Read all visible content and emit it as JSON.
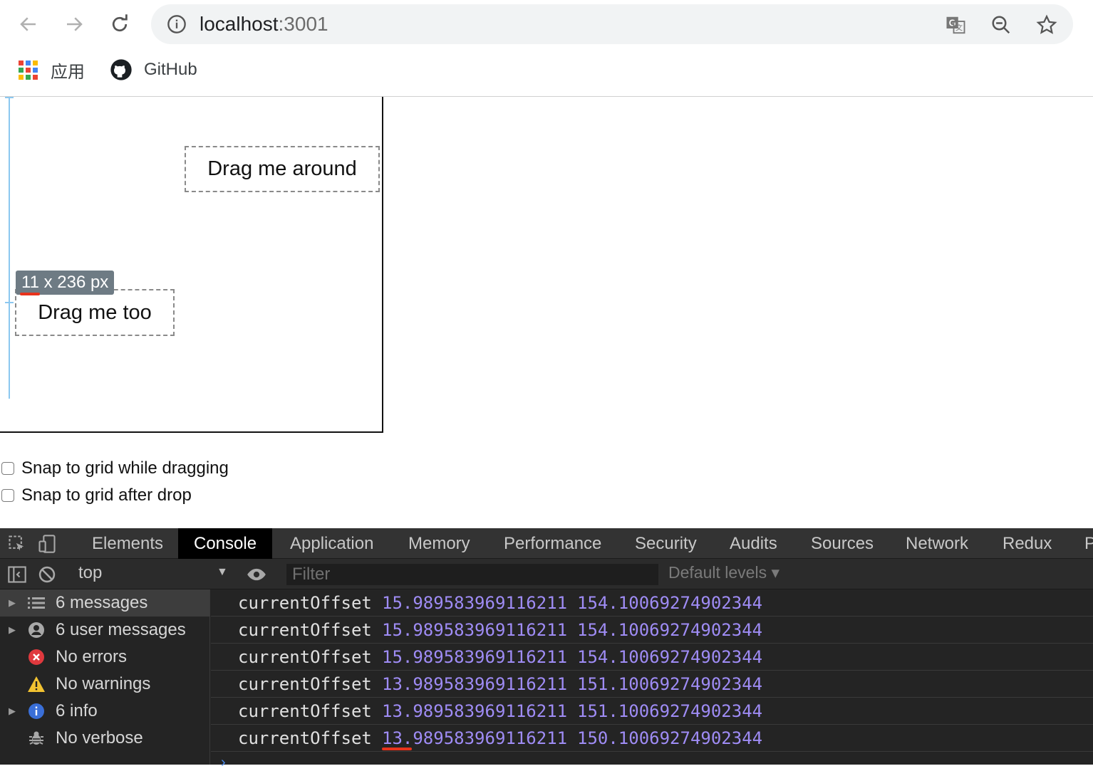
{
  "browser": {
    "url_host": "localhost",
    "url_port": ":3001",
    "bookmarks": [
      {
        "label": "应用",
        "icon": "apps-grid-icon"
      },
      {
        "label": "GitHub",
        "icon": "github-icon"
      }
    ]
  },
  "page": {
    "drag_box_1": "Drag me around",
    "drag_box_2": "Drag me too",
    "size_tooltip": "11 x 236 px",
    "checkboxes": [
      {
        "label": "Snap to grid while dragging",
        "checked": false
      },
      {
        "label": "Snap to grid after drop",
        "checked": false
      }
    ]
  },
  "devtools": {
    "tabs": [
      "Elements",
      "Console",
      "Application",
      "Memory",
      "Performance",
      "Security",
      "Audits",
      "Sources",
      "Network",
      "Redux",
      "P"
    ],
    "active_tab": "Console",
    "context": "top",
    "filter_placeholder": "Filter",
    "levels": "Default levels ▾",
    "sidebar": [
      {
        "label": "6 messages",
        "icon": "list-icon",
        "expandable": true,
        "selected": true
      },
      {
        "label": "6 user messages",
        "icon": "user-icon",
        "expandable": true,
        "selected": false
      },
      {
        "label": "No errors",
        "icon": "error-icon",
        "expandable": false,
        "selected": false
      },
      {
        "label": "No warnings",
        "icon": "warning-icon",
        "expandable": false,
        "selected": false
      },
      {
        "label": "6 info",
        "icon": "info-icon",
        "expandable": true,
        "selected": false
      },
      {
        "label": "No verbose",
        "icon": "bug-icon",
        "expandable": false,
        "selected": false
      }
    ],
    "logs": [
      {
        "key": "currentOffset",
        "x": "15.989583969116211",
        "y": "154.10069274902344"
      },
      {
        "key": "currentOffset",
        "x": "15.989583969116211",
        "y": "154.10069274902344"
      },
      {
        "key": "currentOffset",
        "x": "15.989583969116211",
        "y": "154.10069274902344"
      },
      {
        "key": "currentOffset",
        "x": "13.989583969116211",
        "y": "151.10069274902344"
      },
      {
        "key": "currentOffset",
        "x": "13.989583969116211",
        "y": "151.10069274902344"
      },
      {
        "key": "currentOffset",
        "x": "13.989583969116211",
        "y": "150.10069274902344"
      }
    ],
    "colors": {
      "value": "#9f8cf5",
      "error": "#e0393e",
      "warning": "#f2c331",
      "info": "#3a6fd8"
    }
  }
}
